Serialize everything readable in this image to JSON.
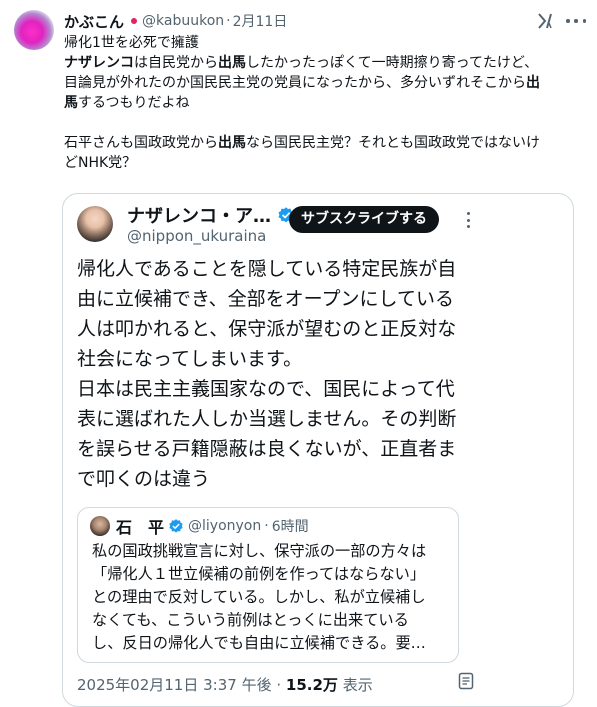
{
  "author": {
    "display_name": "かぶこん",
    "handle": "@kabuukon",
    "separator": "·",
    "date": "2月11日"
  },
  "post_text": {
    "line1": "帰化1世を必死で擁護",
    "line2_bold": "ナザレンコ",
    "line2_rest_a": "は自民党から",
    "line2_bold2": "出馬",
    "line2_rest_b": "したかったっぽくて一時期擦り寄ってたけど、",
    "line3_a": "目論見が外れたのか国民民主党の党員になったから、多分いずれそこから",
    "line3_bold": "出",
    "line4_bold": "馬",
    "line4_rest": "するつもりだよね",
    "line5_a": "石平さんも国政政党から",
    "line5_bold": "出馬",
    "line5_rest": "なら国民民主党？それとも国政政党ではないけ",
    "line6": "どNHK党？"
  },
  "quoted_post": {
    "display_name": "ナザレンコ・ア…",
    "handle": "@nippon_ukuraina",
    "subscribe_label": "サブスクライブする",
    "lines": [
      "帰化人であることを隠している特定民族が自",
      "由に立候補でき、全部をオープンにしている",
      "人は叩かれると、保守派が望むのと正反対な",
      "社会になってしまいます。",
      "日本は民主主義国家なので、国民によって代",
      "表に選ばれた人しか当選しません。その判断",
      "を誤らせる戸籍隠蔽は良くないが、正直者ま",
      "で叩くのは違う"
    ],
    "nested_quote": {
      "display_name": "石　平",
      "handle": "@liyonyon",
      "separator": "·",
      "time": "6時間",
      "lines": [
        "私の国政挑戦宣言に対し、保守派の一部の方々は",
        "「帰化人１世立候補の前例を作ってはならない」",
        "との理由で反対している。しかし、私が立候補し",
        "なくても、こういう前例はとっくに出来ている",
        "し、反日の帰化人でも自由に立候補できる。要…"
      ]
    },
    "timestamp": "2025年02月11日 3:37 午後",
    "separator": "·",
    "views_count": "15.2万",
    "views_label": "表示"
  },
  "colors": {
    "text": "#0f1419",
    "muted": "#536471",
    "border": "#cfd9de",
    "verified": "#1d9bf0",
    "dot": "#e0245e"
  },
  "icons": [
    "grok-icon",
    "more-icon",
    "verified-badge-icon",
    "bookmark-icon"
  ]
}
